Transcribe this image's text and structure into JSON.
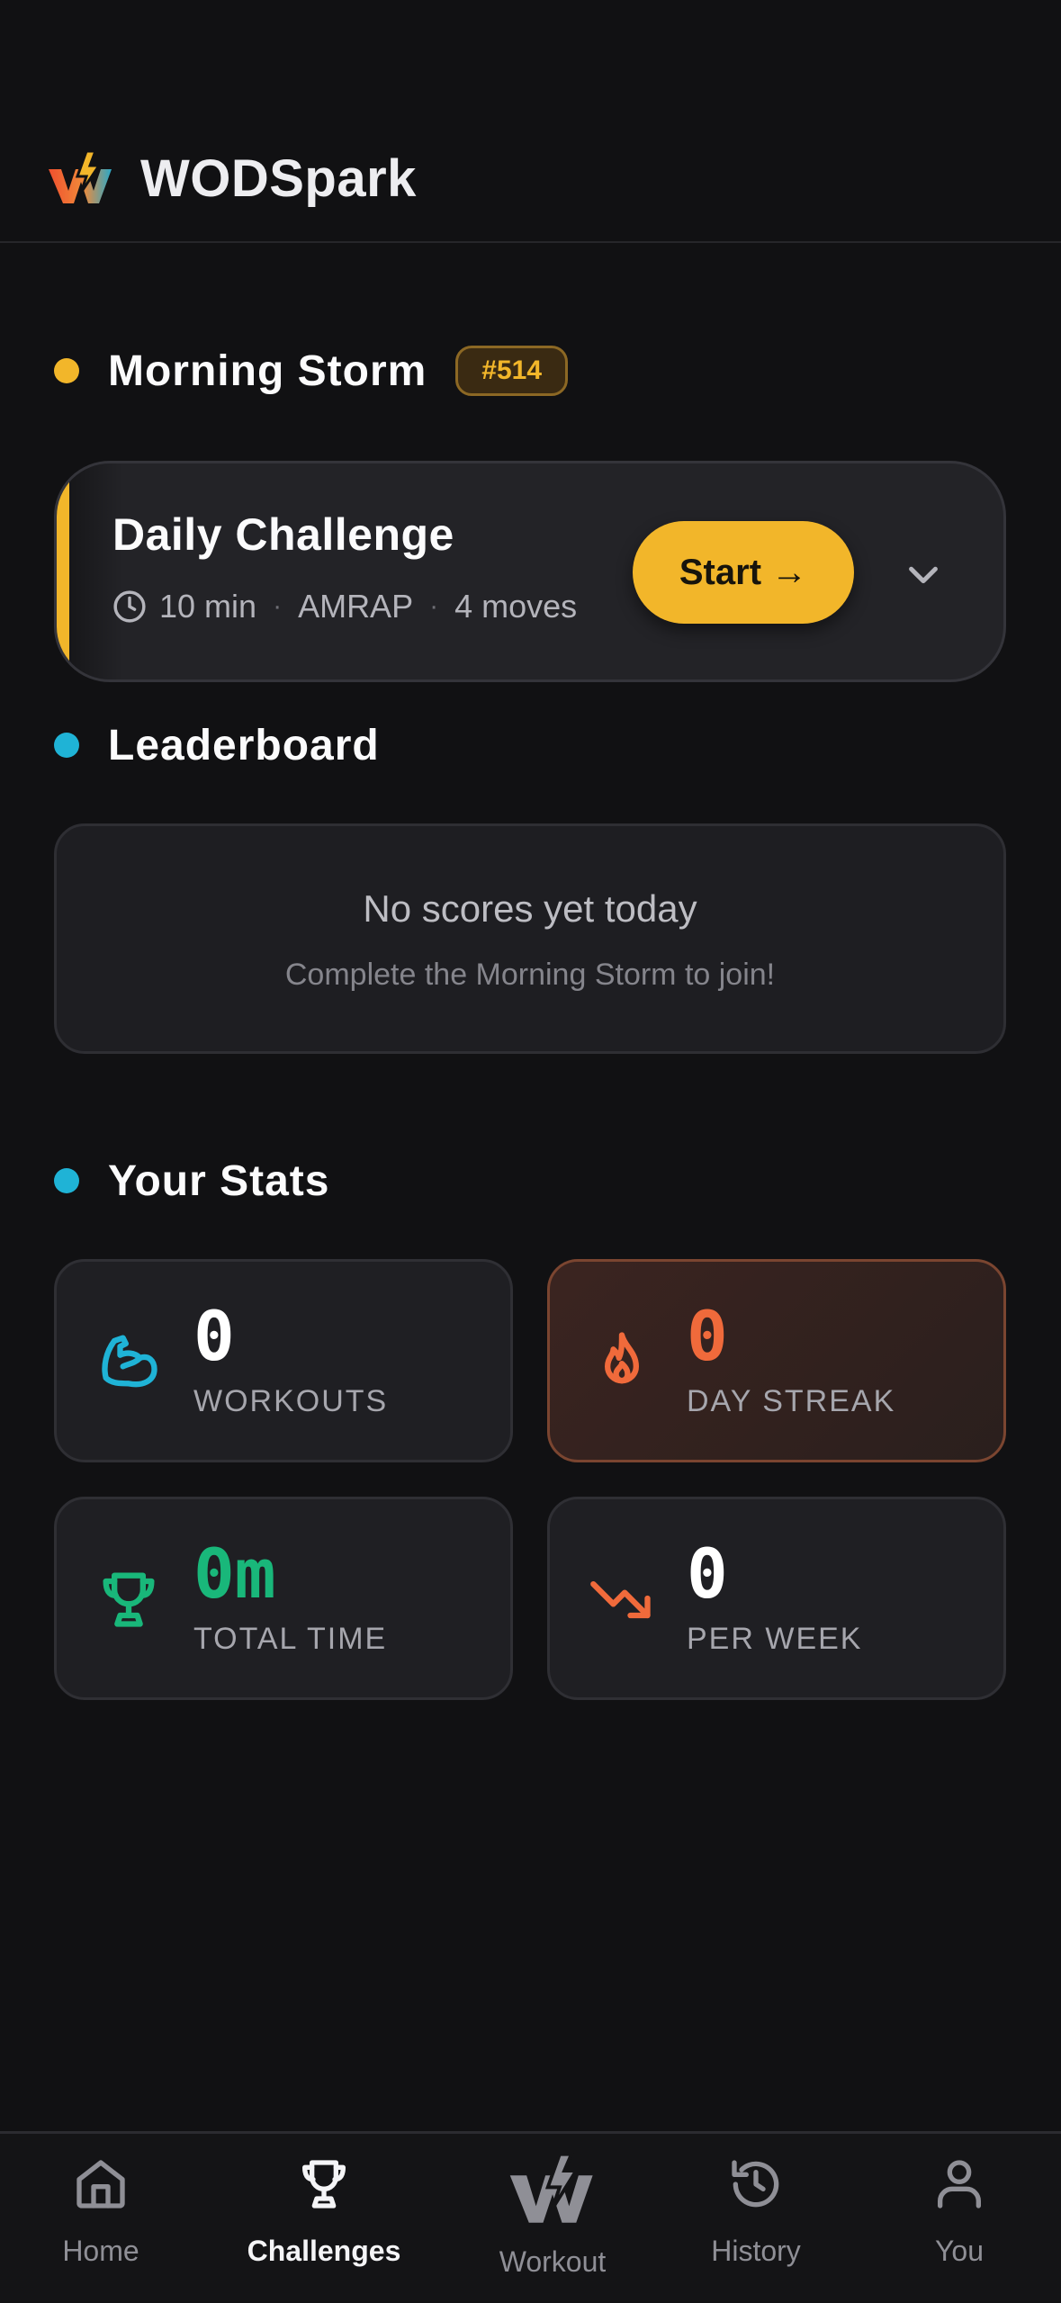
{
  "app": {
    "title": "WODSpark"
  },
  "morning": {
    "title": "Morning Storm",
    "badge": "#514",
    "dot_color": "#f2b62a"
  },
  "challenge": {
    "title": "Daily Challenge",
    "duration": "10 min",
    "format": "AMRAP",
    "moves": "4 moves",
    "separator": "·",
    "start_label": "Start →"
  },
  "leaderboard": {
    "title": "Leaderboard",
    "empty_title": "No scores yet today",
    "empty_sub": "Complete the Morning Storm to join!",
    "dot_color": "#1fb3d6"
  },
  "stats": {
    "title": "Your Stats",
    "items": [
      {
        "value": "0",
        "label": "WORKOUTS",
        "icon": "bicep-icon",
        "color": "#1fb3d6",
        "value_color": "#ffffff"
      },
      {
        "value": "0",
        "label": "DAY STREAK",
        "icon": "flame-icon",
        "color": "#f06a3b",
        "value_color": "#f06a3b"
      },
      {
        "value": "0m",
        "label": "TOTAL TIME",
        "icon": "trophy-icon",
        "color": "#19b77a",
        "value_color": "#19b77a"
      },
      {
        "value": "0",
        "label": "PER WEEK",
        "icon": "trend-down-icon",
        "color": "#f06a3b",
        "value_color": "#ffffff"
      }
    ]
  },
  "nav": {
    "items": [
      {
        "label": "Home",
        "icon": "home-icon"
      },
      {
        "label": "Challenges",
        "icon": "trophy-icon",
        "active": true
      },
      {
        "label": "Workout",
        "icon": "wodspark-logo-icon"
      },
      {
        "label": "History",
        "icon": "history-icon"
      },
      {
        "label": "You",
        "icon": "user-icon"
      }
    ]
  }
}
